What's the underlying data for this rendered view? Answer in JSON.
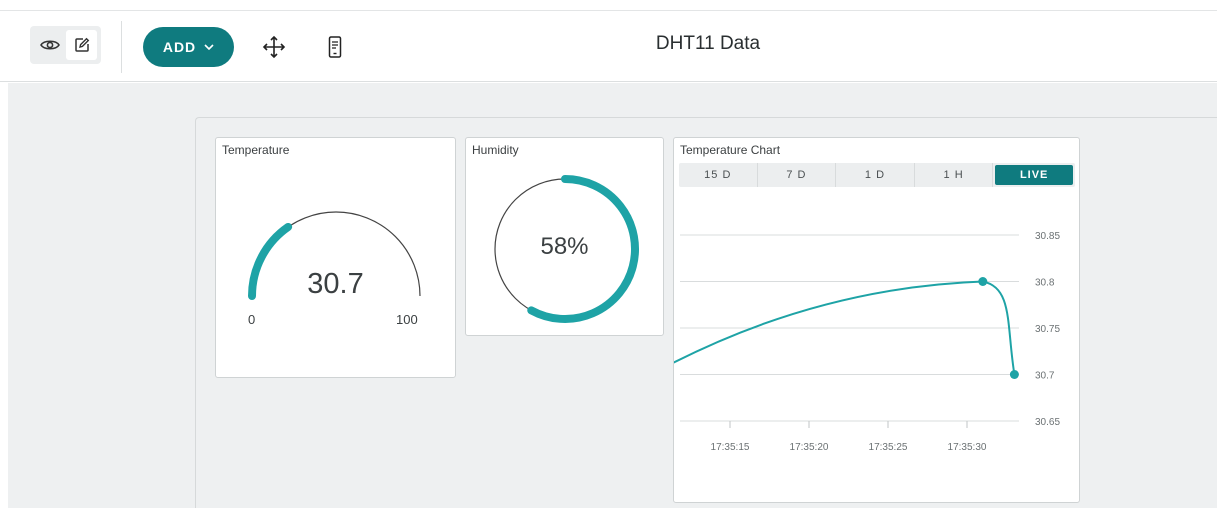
{
  "toolbar": {
    "add_label": "ADD",
    "view_icon": "eye-icon",
    "edit_icon": "edit-icon",
    "move_icon": "move-icon",
    "mobile_icon": "mobile-icon"
  },
  "dashboard": {
    "title": "DHT11 Data"
  },
  "colors": {
    "accent": "#0f7b7f",
    "gauge": "#1ea3a6"
  },
  "widgets": {
    "temperature": {
      "title": "Temperature",
      "value": "30.7",
      "min": "0",
      "max": "100",
      "fraction": 0.307
    },
    "humidity": {
      "title": "Humidity",
      "value": "58%",
      "fraction": 0.58
    },
    "chart": {
      "title": "Temperature Chart",
      "tabs": [
        "15 D",
        "7 D",
        "1 D",
        "1 H",
        "LIVE"
      ],
      "active_tab": "LIVE"
    }
  },
  "chart_data": {
    "type": "line",
    "title": "Temperature Chart",
    "x": [
      "17:35:10",
      "17:35:31",
      "17:35:33"
    ],
    "values": [
      30.7,
      30.8,
      30.7
    ],
    "xticks": [
      "17:35:15",
      "17:35:20",
      "17:35:25",
      "17:35:30"
    ],
    "yticks": [
      "30.85",
      "30.8",
      "30.75",
      "30.7",
      "30.65"
    ],
    "ylim": [
      30.65,
      30.85
    ],
    "grid": true
  }
}
